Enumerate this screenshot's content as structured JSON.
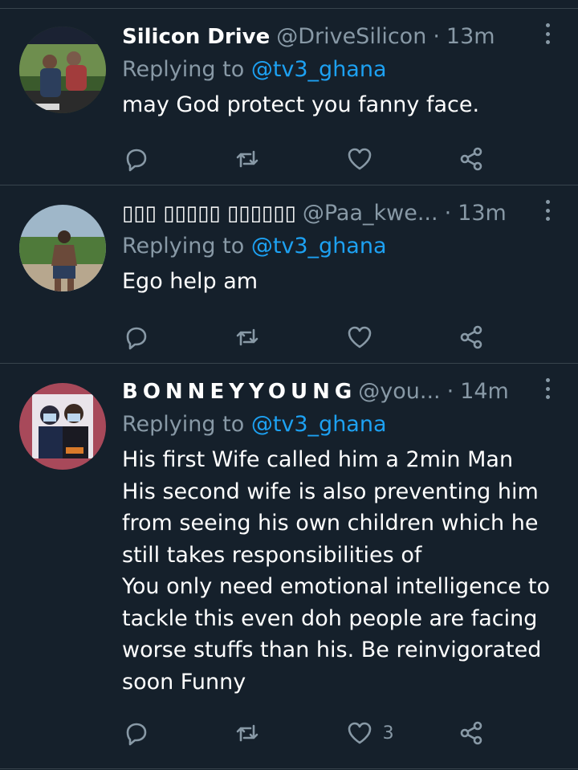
{
  "tweets": [
    {
      "display_name": "Silicon Drive",
      "handle": "@DriveSilicon",
      "time": "13m",
      "replying_prefix": "Replying to ",
      "mention": "@tv3_ghana",
      "body": "may God protect you fanny face.",
      "likes": ""
    },
    {
      "display_name": "▯▯▯ ▯▯▯▯▯ ▯▯▯▯▯▯",
      "handle": "@Paa_kwe...",
      "time": "13m",
      "replying_prefix": "Replying to ",
      "mention": "@tv3_ghana",
      "body": "Ego help am",
      "likes": ""
    },
    {
      "display_name": "BONNEYYOUNG",
      "handle": "@you...",
      "time": "14m",
      "replying_prefix": "Replying to ",
      "mention": "@tv3_ghana",
      "body": "His first Wife called him a 2min Man\nHis second wife is also preventing him from seeing his own children which he still takes responsibilities of\nYou only need emotional intelligence to tackle this even doh people are facing worse stuffs than his. Be reinvigorated soon Funny",
      "likes": "3"
    }
  ],
  "colors": {
    "background": "#15202b",
    "divider": "#38444d",
    "secondary_text": "#8899a6",
    "link": "#1da1f2"
  },
  "icons": [
    "reply-icon",
    "retweet-icon",
    "like-icon",
    "share-icon",
    "more-icon"
  ]
}
